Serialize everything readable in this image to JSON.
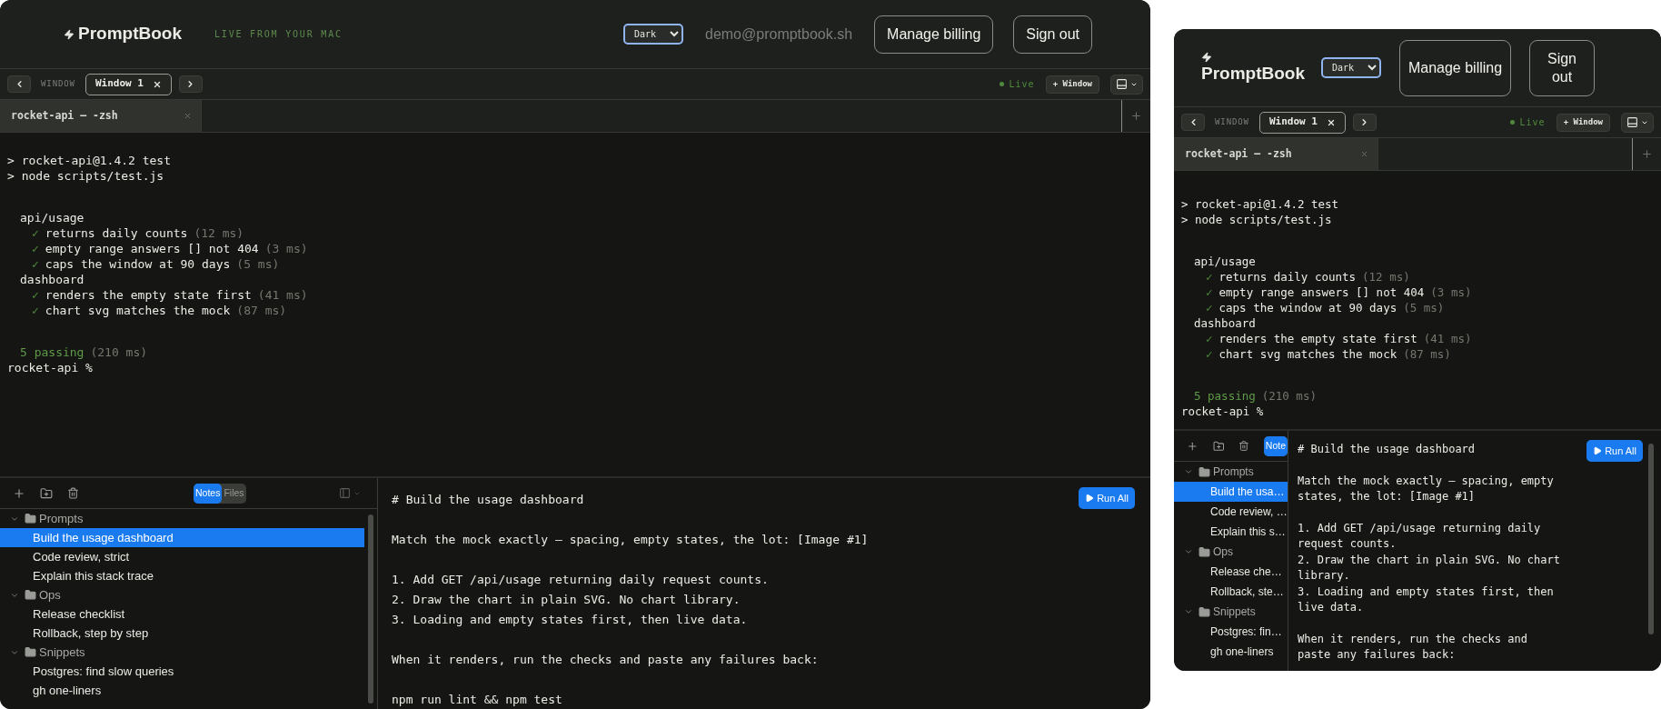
{
  "views": [
    {
      "header": {
        "logo": "PromptBook",
        "tagline": "LIVE FROM YOUR MAC",
        "theme": "Dark",
        "email": "demo@promptbook.sh",
        "buttons": [
          "Manage billing",
          "Sign out"
        ]
      },
      "window_bar": {
        "label": "WINDOW",
        "tabs": [
          {
            "label": "Window 1",
            "selected": true
          }
        ],
        "status": "Live",
        "new_window": "+ Window"
      },
      "terminal_tabs": [
        {
          "label": "rocket-api — -zsh",
          "selected": true
        }
      ],
      "terminal": [
        {
          "kind": "command",
          "text": "> rocket-api@1.4.2 test"
        },
        {
          "kind": "command",
          "text": "> node scripts/test.js"
        },
        {
          "kind": "gap"
        },
        {
          "kind": "suite",
          "text": "api/usage"
        },
        {
          "kind": "test",
          "mark": "✓",
          "text": "returns daily counts",
          "time": "(12 ms)"
        },
        {
          "kind": "test",
          "mark": "✓",
          "text": "empty range answers [] not 404",
          "time": "(3 ms)"
        },
        {
          "kind": "test",
          "mark": "✓",
          "text": "caps the window at 90 days",
          "time": "(5 ms)"
        },
        {
          "kind": "suite",
          "text": "dashboard"
        },
        {
          "kind": "test",
          "mark": "✓",
          "text": "renders the empty state first",
          "time": "(41 ms)"
        },
        {
          "kind": "test",
          "mark": "✓",
          "text": "chart svg matches the mock",
          "time": "(87 ms)"
        },
        {
          "kind": "gap"
        },
        {
          "kind": "summary",
          "text": "5 passing",
          "time": "(210 ms)"
        },
        {
          "kind": "prompt",
          "text": "rocket-api %"
        }
      ],
      "sidebar": {
        "segments": [
          {
            "label": "Notes",
            "selected": true
          },
          {
            "label": "Files",
            "selected": false
          }
        ],
        "tree": [
          {
            "label": "Prompts",
            "expanded": true,
            "children": [
              {
                "label": "Build the usage dashboard",
                "selected": true
              },
              {
                "label": "Code review, strict",
                "selected": false
              },
              {
                "label": "Explain this stack trace",
                "selected": false
              }
            ]
          },
          {
            "label": "Ops",
            "expanded": true,
            "children": [
              {
                "label": "Release checklist",
                "selected": false
              },
              {
                "label": "Rollback, step by step",
                "selected": false
              }
            ]
          },
          {
            "label": "Snippets",
            "expanded": true,
            "children": [
              {
                "label": "Postgres: find slow queries",
                "selected": false
              },
              {
                "label": "gh one-liners",
                "selected": false
              }
            ]
          }
        ]
      },
      "note": {
        "run_button": "Run All",
        "paragraphs": [
          [
            "# Build the usage dashboard"
          ],
          [
            "Match the mock exactly — spacing, empty states, the lot: [Image #1]"
          ],
          [
            "1. Add GET /api/usage returning daily request counts.",
            "2. Draw the chart in plain SVG. No chart library.",
            "3. Loading and empty states first, then live data."
          ],
          [
            "When it renders, run the checks and paste any failures back:"
          ],
          [
            "npm run lint && npm test"
          ]
        ]
      }
    },
    {
      "header": {
        "logo": "PromptBook",
        "theme": "Dark",
        "buttons": [
          "Manage billing",
          "Sign out"
        ]
      },
      "window_bar": {
        "label": "WINDOW",
        "tabs": [
          {
            "label": "Window 1",
            "selected": true
          }
        ],
        "status": "Live",
        "new_window": "+ Window"
      },
      "terminal_tabs": [
        {
          "label": "rocket-api — -zsh",
          "selected": true
        }
      ],
      "terminal": [
        {
          "kind": "command",
          "text": "> rocket-api@1.4.2 test"
        },
        {
          "kind": "command",
          "text": "> node scripts/test.js"
        },
        {
          "kind": "gap"
        },
        {
          "kind": "suite",
          "text": "api/usage"
        },
        {
          "kind": "test",
          "mark": "✓",
          "text": "returns daily counts",
          "time": "(12 ms)"
        },
        {
          "kind": "test",
          "mark": "✓",
          "text": "empty range answers [] not 404",
          "time": "(3 ms)"
        },
        {
          "kind": "test",
          "mark": "✓",
          "text": "caps the window at 90 days",
          "time": "(5 ms)"
        },
        {
          "kind": "suite",
          "text": "dashboard"
        },
        {
          "kind": "test",
          "mark": "✓",
          "text": "renders the empty state first",
          "time": "(41 ms)"
        },
        {
          "kind": "test",
          "mark": "✓",
          "text": "chart svg matches the mock",
          "time": "(87 ms)"
        },
        {
          "kind": "gap"
        },
        {
          "kind": "summary",
          "text": "5 passing",
          "time": "(210 ms)"
        },
        {
          "kind": "prompt",
          "text": "rocket-api %"
        }
      ],
      "sidebar": {
        "segments": [
          {
            "label": "Note",
            "selected": true
          }
        ],
        "tree": [
          {
            "label": "Prompts",
            "expanded": true,
            "children": [
              {
                "label": "Build the usa…",
                "selected": true
              },
              {
                "label": "Code review, …",
                "selected": false
              },
              {
                "label": "Explain this s…",
                "selected": false
              }
            ]
          },
          {
            "label": "Ops",
            "expanded": true,
            "children": [
              {
                "label": "Release che…",
                "selected": false
              },
              {
                "label": "Rollback, ste…",
                "selected": false
              }
            ]
          },
          {
            "label": "Snippets",
            "expanded": true,
            "children": [
              {
                "label": "Postgres: fin…",
                "selected": false
              },
              {
                "label": "gh one-liners",
                "selected": false
              }
            ]
          }
        ]
      },
      "note": {
        "run_button": "Run All",
        "paragraphs": [
          [
            "# Build the usage dashboard"
          ],
          [
            "Match the mock exactly — spacing, empty states, the lot: [Image #1]"
          ],
          [
            "1. Add GET /api/usage returning daily request counts.",
            "2. Draw the chart in plain SVG. No chart library.",
            "3. Loading and empty states first, then live data."
          ],
          [
            "When it renders, run the checks and paste any failures back:"
          ]
        ]
      }
    }
  ]
}
